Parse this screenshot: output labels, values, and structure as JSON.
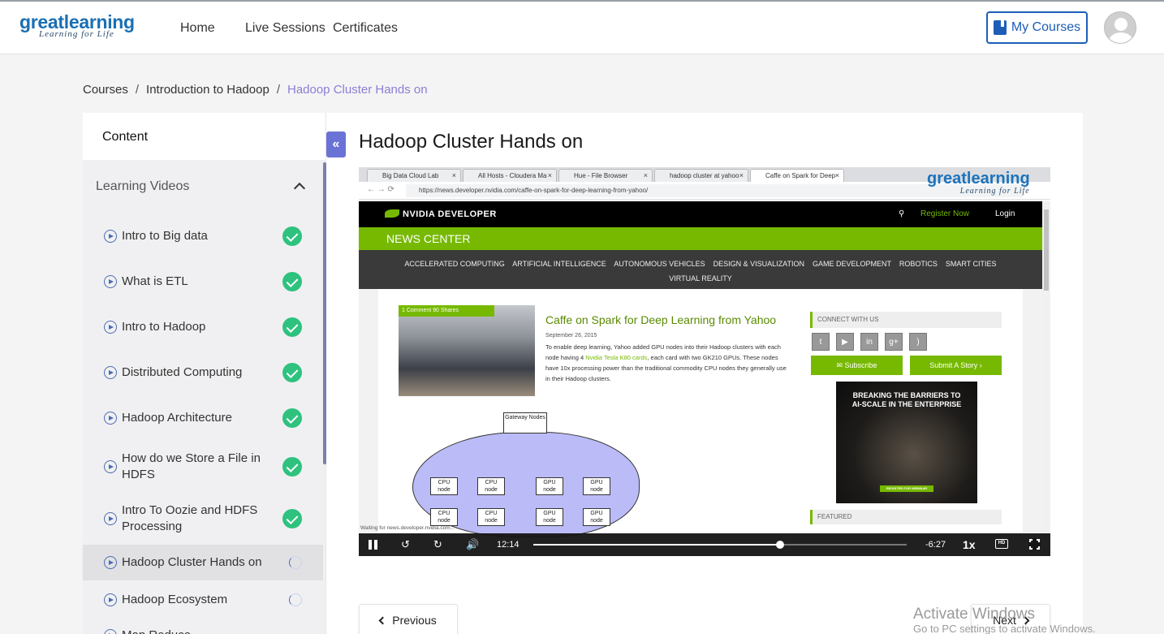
{
  "header": {
    "logo_brand": "greatlearning",
    "logo_tagline": "Learning for Life",
    "nav": [
      "Home",
      "Live Sessions",
      "Certificates"
    ],
    "my_courses_label": "My Courses"
  },
  "breadcrumb": {
    "items": [
      "Courses",
      "Introduction to Hadoop",
      "Hadoop Cluster Hands on"
    ],
    "separator": "/"
  },
  "sidebar": {
    "title": "Content",
    "section_title": "Learning Videos",
    "items": [
      {
        "label": "Intro to Big data",
        "status": "completed"
      },
      {
        "label": "What is ETL",
        "status": "completed"
      },
      {
        "label": "Intro to Hadoop",
        "status": "completed"
      },
      {
        "label": "Distributed Computing",
        "status": "completed"
      },
      {
        "label": "Hadoop Architecture",
        "status": "completed"
      },
      {
        "label": "How do we Store a File in HDFS",
        "status": "completed"
      },
      {
        "label": "Intro To Oozie and HDFS Processing",
        "status": "completed"
      },
      {
        "label": "Hadoop Cluster Hands on",
        "status": "in-progress"
      },
      {
        "label": "Hadoop Ecosystem",
        "status": "in-progress"
      },
      {
        "label": "Map Reduce",
        "status": "not-started"
      }
    ]
  },
  "main": {
    "lesson_title": "Hadoop Cluster Hands on",
    "previous_label": "Previous",
    "next_label": "Next"
  },
  "video": {
    "browser_tabs": [
      "Big Data Cloud Lab",
      "All Hosts - Cloudera Ma",
      "Hue - File Browser",
      "hadoop cluster at yahoo",
      "Caffe on Spark for Deep"
    ],
    "url": "https://news.developer.nvidia.com/caffe-on-spark-for-deep-learning-from-yahoo/",
    "watermark_brand": "greatlearning",
    "watermark_tagline": "Learning for Life",
    "site_logo": "NVIDIA DEVELOPER",
    "register": "Register Now",
    "login": "Login",
    "news_center": "NEWS CENTER",
    "categories_line1": "ACCELERATED COMPUTING    ARTIFICIAL INTELLIGENCE    AUTONOMOUS VEHICLES    DESIGN & VISUALIZATION    GAME DEVELOPMENT    ROBOTICS    SMART CITIES",
    "categories_line2": "VIRTUAL REALITY",
    "article_badge": "1 Comment   90 Shares",
    "article_title": "Caffe on Spark for Deep Learning from Yahoo",
    "article_date": "September 26, 2015",
    "article_body_1": "To enable deep learning, Yahoo added GPU nodes into their Hadoop clusters with each node having 4 ",
    "article_body_link": "Nvidia Tesla K80 cards",
    "article_body_2": ", each card with two GK210 GPUs. These nodes have 10x  processing power than the traditional commodity CPU nodes they generally use in their Hadoop clusters.",
    "connect": "CONNECT WITH US",
    "subscribe": "Subscribe",
    "submit_story": "Submit A Story",
    "ad_line1": "BREAKING THE BARRIERS TO",
    "ad_line2": "AI-SCALE IN THE ENTERPRISE",
    "ad_cta": "REGISTER FOR WEBINAR",
    "featured": "FEATURED",
    "diagram_gateway": "Gateway Nodes",
    "diagram_cpu": "CPU node",
    "diagram_gpu": "GPU node",
    "status_text": "Waiting for news.developer.nvidia.com...",
    "elapsed": "12:14",
    "remaining": "-6:27",
    "speed": "1x",
    "progress_fraction": 0.66
  },
  "os": {
    "watermark_title": "Activate Windows",
    "watermark_sub": "Go to PC settings to activate Windows."
  }
}
